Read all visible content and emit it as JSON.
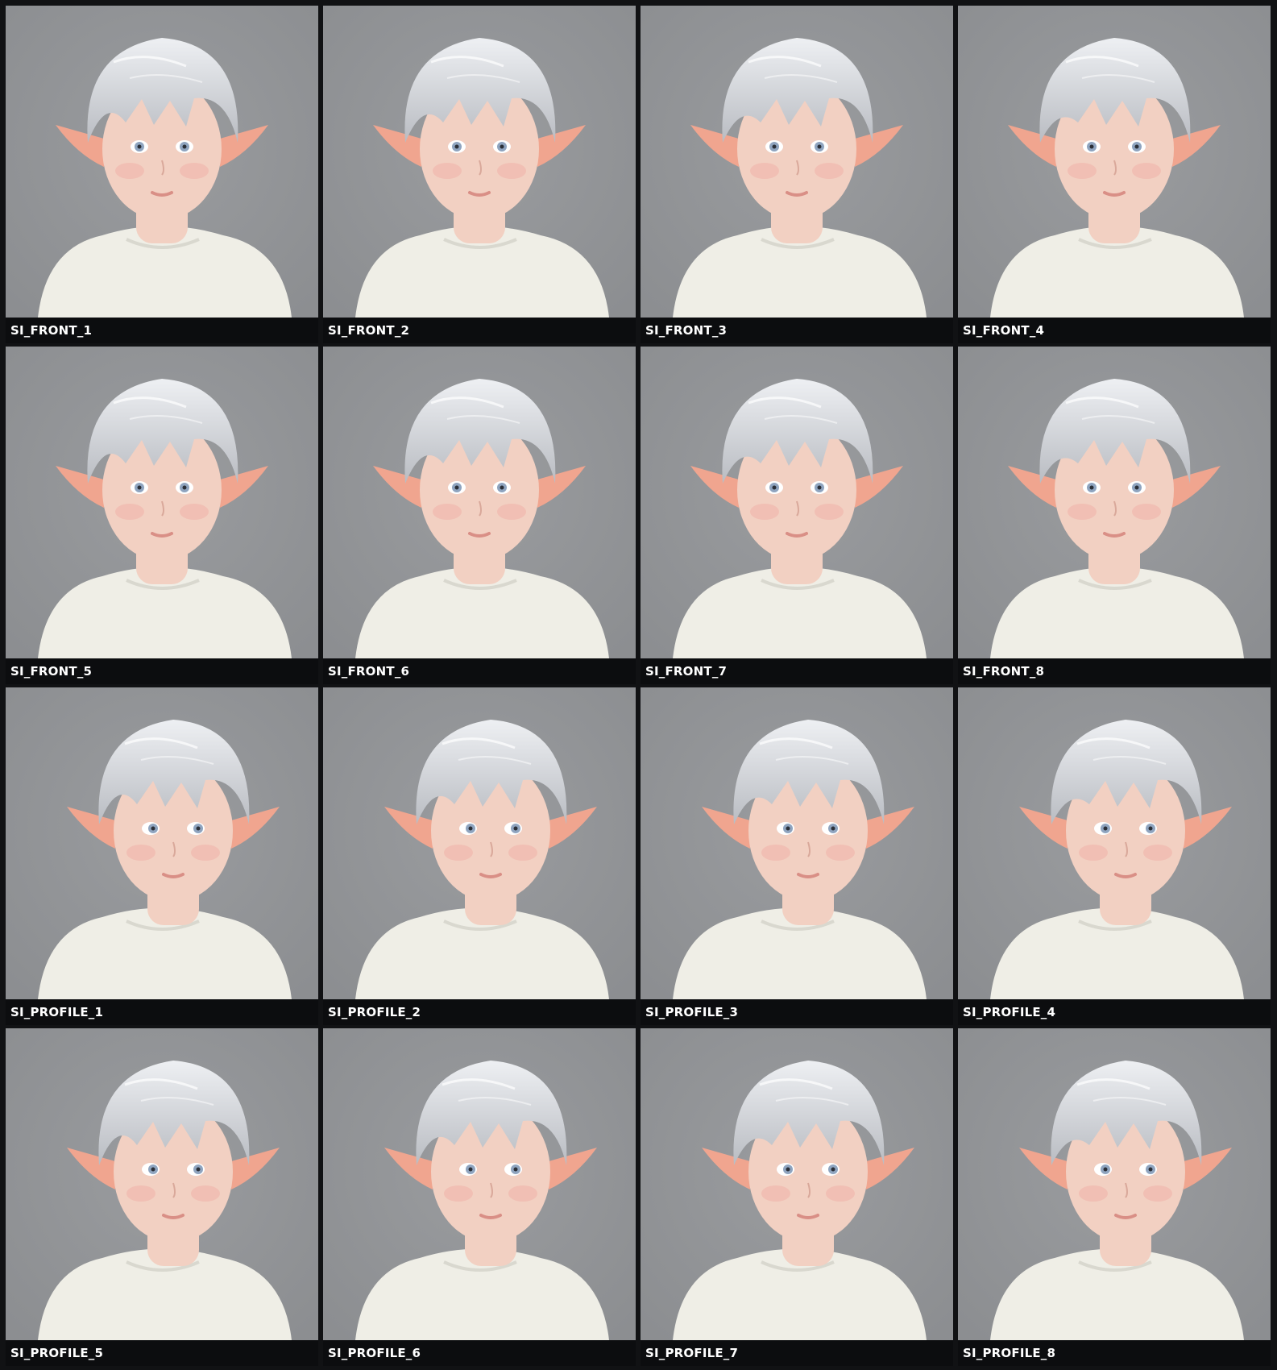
{
  "colors": {
    "frame_bg": "#111214",
    "caption_bg": "#0c0d0f",
    "caption_text": "#ffffff",
    "photo_bg": "#8c8e91",
    "hair": "#d7d9dd",
    "skin": "#f2d0c2",
    "ear": "#f0a58f",
    "shirt": "#efeee6",
    "eye": "#8fa4bf"
  },
  "tiles": [
    {
      "label": "SI_FRONT_1",
      "view": "front"
    },
    {
      "label": "SI_FRONT_2",
      "view": "front"
    },
    {
      "label": "SI_FRONT_3",
      "view": "front"
    },
    {
      "label": "SI_FRONT_4",
      "view": "front"
    },
    {
      "label": "SI_FRONT_5",
      "view": "front"
    },
    {
      "label": "SI_FRONT_6",
      "view": "front"
    },
    {
      "label": "SI_FRONT_7",
      "view": "front"
    },
    {
      "label": "SI_FRONT_8",
      "view": "front"
    },
    {
      "label": "SI_PROFILE_1",
      "view": "profile"
    },
    {
      "label": "SI_PROFILE_2",
      "view": "profile"
    },
    {
      "label": "SI_PROFILE_3",
      "view": "profile"
    },
    {
      "label": "SI_PROFILE_4",
      "view": "profile"
    },
    {
      "label": "SI_PROFILE_5",
      "view": "profile"
    },
    {
      "label": "SI_PROFILE_6",
      "view": "profile"
    },
    {
      "label": "SI_PROFILE_7",
      "view": "profile"
    },
    {
      "label": "SI_PROFILE_8",
      "view": "profile"
    }
  ]
}
